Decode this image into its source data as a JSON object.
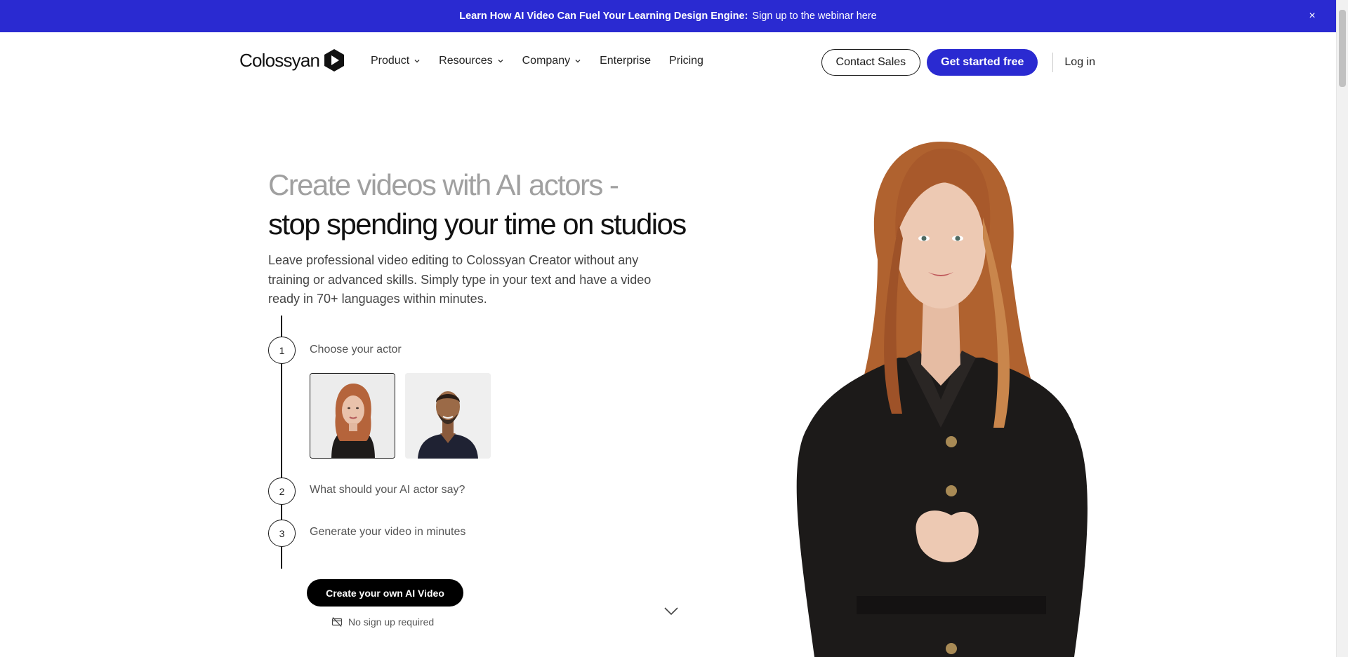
{
  "banner": {
    "bold_text": "Learn How AI Video Can Fuel Your Learning Design Engine:",
    "link_text": "Sign up to the webinar here",
    "close_label": "×"
  },
  "nav": {
    "logo_text": "Colossyan",
    "links": [
      {
        "label": "Product",
        "has_dropdown": true
      },
      {
        "label": "Resources",
        "has_dropdown": true
      },
      {
        "label": "Company",
        "has_dropdown": true
      },
      {
        "label": "Enterprise",
        "has_dropdown": false
      },
      {
        "label": "Pricing",
        "has_dropdown": false
      }
    ],
    "contact_sales": "Contact Sales",
    "get_started": "Get started free",
    "login": "Log in"
  },
  "hero": {
    "title_line1": "Create videos with AI actors -",
    "title_line2": "stop spending your time on studios",
    "description": "Leave professional video editing to Colossyan Creator without any training or advanced skills. Simply type in your text and have a video ready in 70+ languages within minutes."
  },
  "steps": [
    {
      "number": "1",
      "label": "Choose your actor"
    },
    {
      "number": "2",
      "label": "What should your AI actor say?"
    },
    {
      "number": "3",
      "label": "Generate your video in minutes"
    }
  ],
  "cta": {
    "button_label": "Create your own AI Video",
    "note": "No sign up required"
  },
  "colors": {
    "brand": "#2a2ad1",
    "dark": "#000000"
  }
}
